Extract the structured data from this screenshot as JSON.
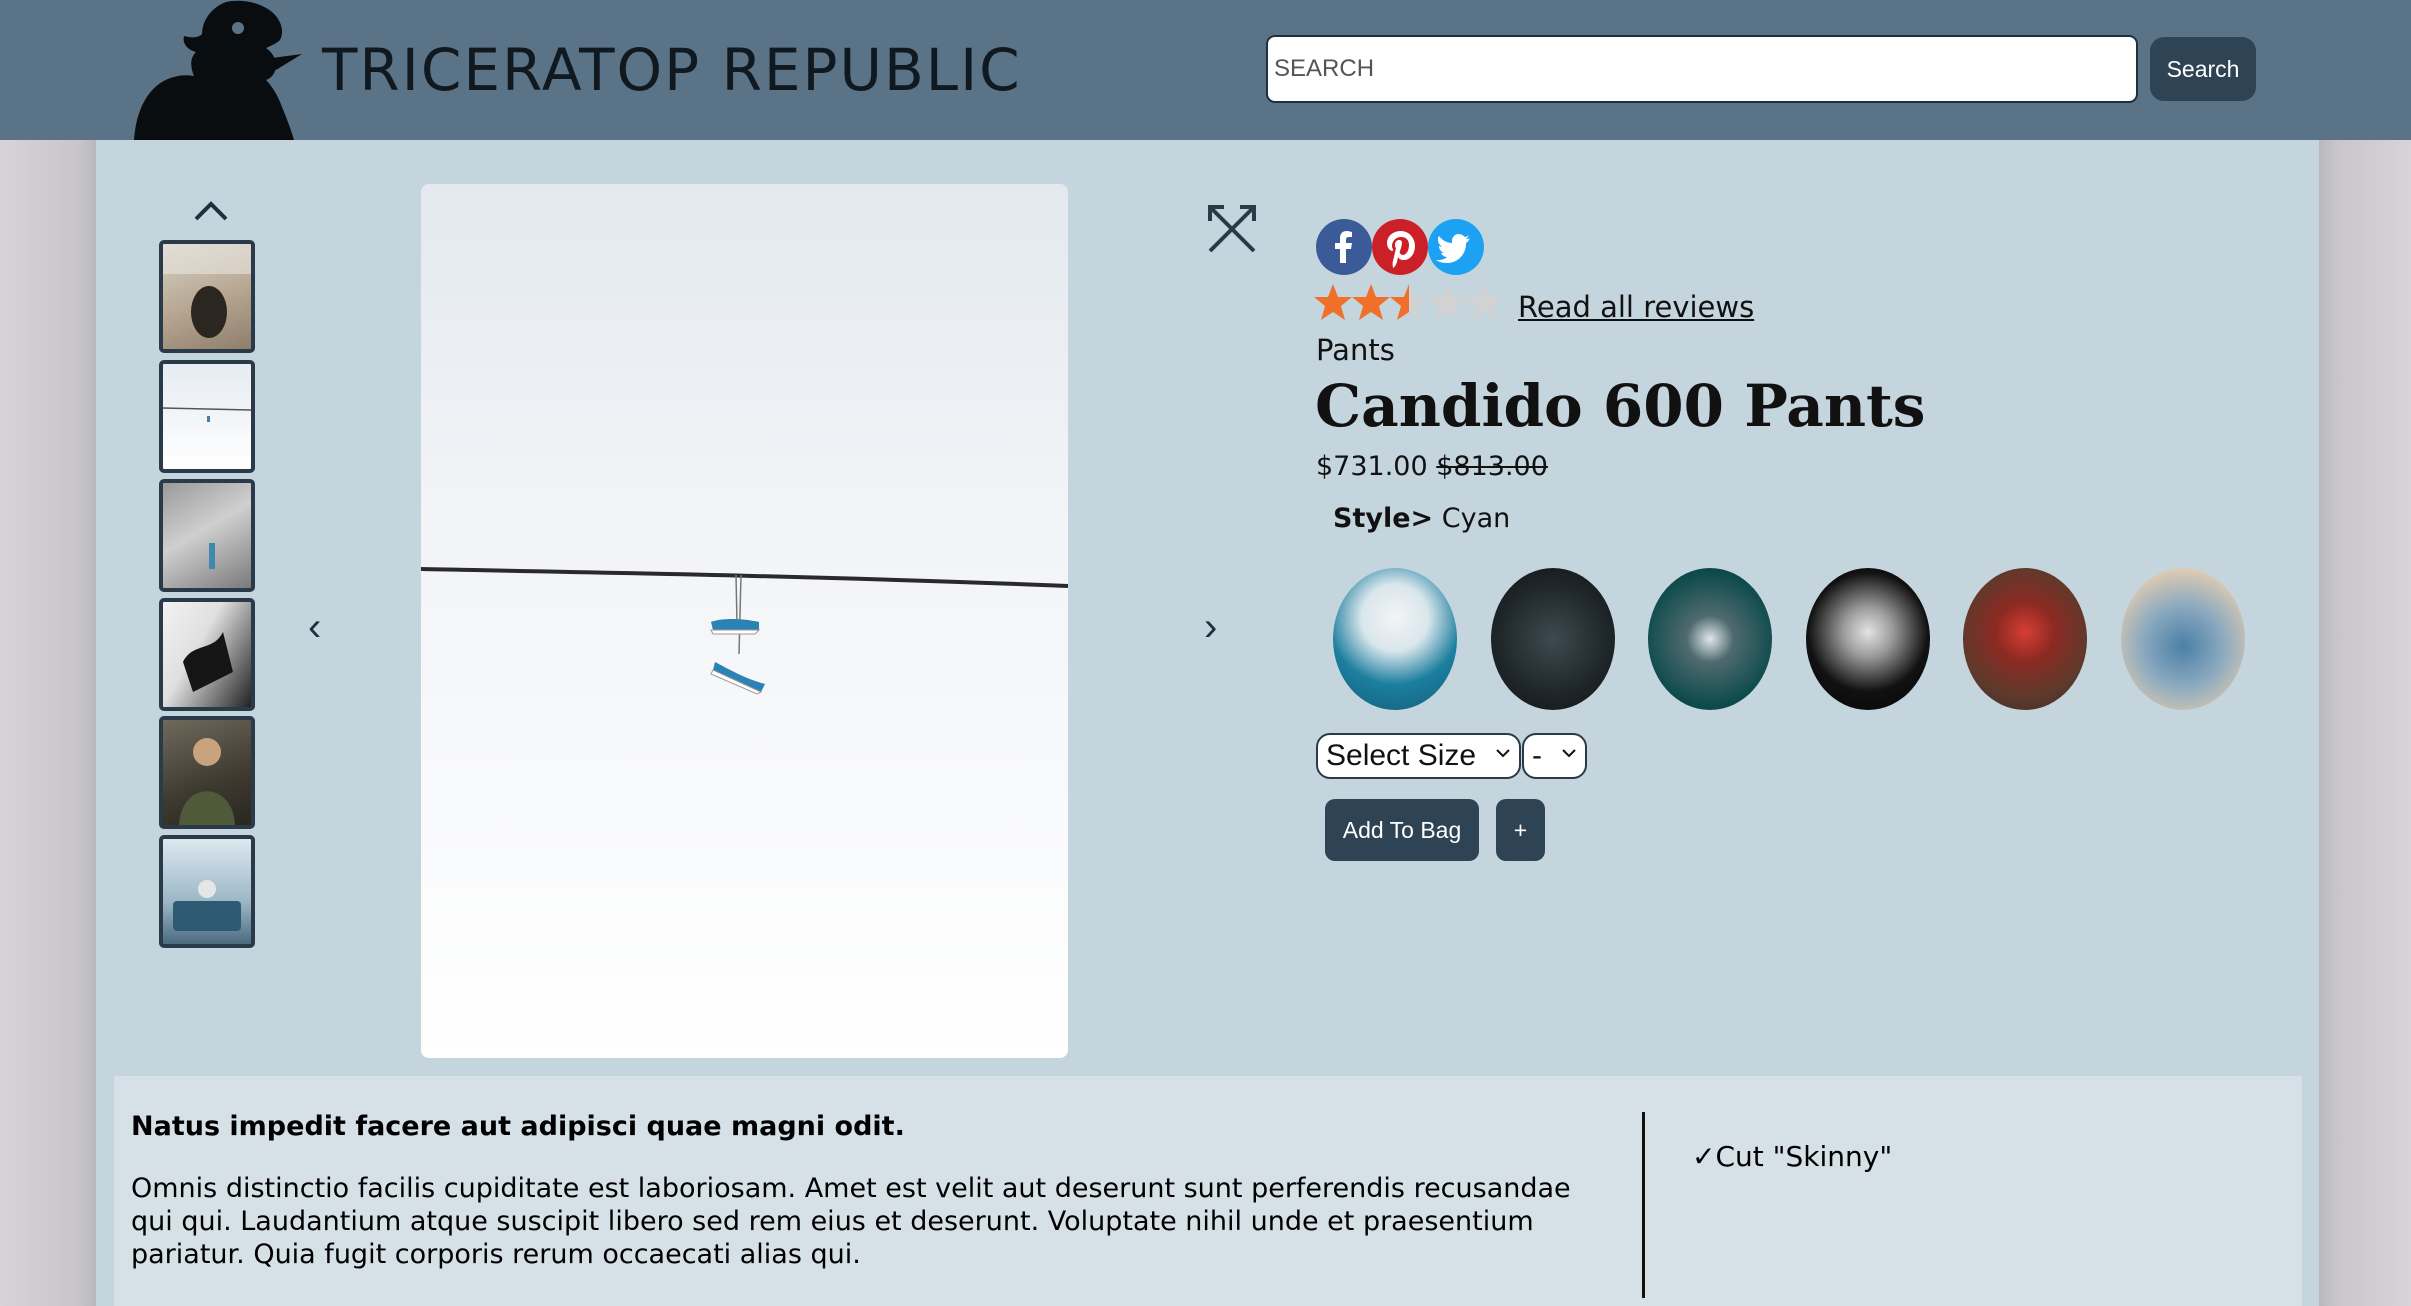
{
  "header": {
    "brand": "TRICERATOP REPUBLIC",
    "search_placeholder": "SEARCH",
    "search_button": "Search",
    "logo_icon": "triceratops-silhouette-icon"
  },
  "gallery": {
    "up_icon": "chevron-up-icon",
    "prev_glyph": "‹",
    "next_glyph": "›",
    "thumbnails": [
      "shoe-on-floor",
      "sneakers-on-wire",
      "person-in-fog",
      "hand-with-shoe",
      "person-in-camo",
      "person-on-couch"
    ],
    "main_image": "sneakers hanging from wire"
  },
  "product": {
    "expand_icon": "expand-arrows-icon",
    "social": [
      "facebook-icon",
      "pinterest-icon",
      "twitter-icon"
    ],
    "rating": 2.5,
    "rating_max": 5,
    "reviews_link": "Read all reviews",
    "category": "Pants",
    "name": "Candido 600 Pants",
    "price_sale": "$731.00",
    "price_original": "$813.00",
    "style_label": "Style>",
    "style_value": "Cyan",
    "size_select": "Select Size",
    "qty_select": "-",
    "add_to_bag": "Add To Bag",
    "plus": "+"
  },
  "colors": {
    "header_bg": "#5b7386",
    "panel_bg": "#c5d5de",
    "button_bg": "#2e4353",
    "star_on": "#f06f2b",
    "star_off": "#d2d2d2"
  },
  "description": {
    "heading": "Natus impedit facere aut adipisci quae magni odit.",
    "body": "Omnis distinctio facilis cupiditate est laboriosam. Amet est velit aut deserunt sunt perferendis recusandae qui qui. Laudantium atque suscipit libero sed rem eius et deserunt. Voluptate nihil unde et praesentium pariatur. Quia fugit corporis rerum occaecati alias qui.",
    "feature": "✓Cut \"Skinny\""
  }
}
